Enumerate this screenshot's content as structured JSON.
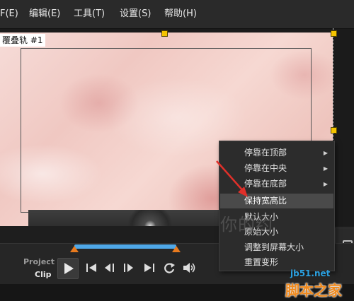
{
  "menubar": {
    "items": [
      {
        "label": "F(E)"
      },
      {
        "label": "编辑(E)"
      },
      {
        "label": "工具(T)"
      },
      {
        "label": "设置(S)"
      },
      {
        "label": "帮助(H)"
      }
    ]
  },
  "preview": {
    "track_label": "覆叠轨 #1"
  },
  "player": {
    "mode_project": "Project",
    "mode_clip": "Clip",
    "active_mode": "Clip",
    "controls": [
      "play-icon",
      "go-to-start-icon",
      "previous-frame-icon",
      "next-frame-icon",
      "go-to-end-icon",
      "repeat-icon",
      "volume-icon"
    ],
    "marker_color": "#e87a1e",
    "scrub_color": "#4fa8e8"
  },
  "context_menu": {
    "items": [
      {
        "label": "停靠在顶部",
        "has_submenu": true
      },
      {
        "label": "停靠在中央",
        "has_submenu": true
      },
      {
        "label": "停靠在底部",
        "has_submenu": true
      },
      {
        "label": "保持宽高比",
        "has_submenu": false,
        "highlighted": true
      },
      {
        "label": "默认大小",
        "has_submenu": false
      },
      {
        "label": "原始大小",
        "has_submenu": false
      },
      {
        "label": "调整到屏幕大小",
        "has_submenu": false
      },
      {
        "label": "重置变形",
        "has_submenu": false
      }
    ]
  },
  "annotation": {
    "arrow_color": "#e0302a"
  },
  "watermarks": {
    "author": "你的约",
    "site": "jb51.net",
    "brand": "脚本之家"
  }
}
